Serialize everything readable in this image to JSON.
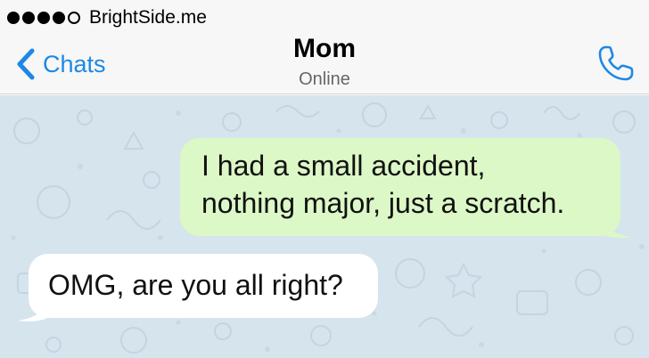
{
  "status_bar": {
    "carrier": "BrightSide.me",
    "signal_filled": 4,
    "signal_total": 5
  },
  "nav": {
    "back_label": "Chats",
    "back_icon": "chevron-left-icon",
    "call_icon": "phone-icon"
  },
  "contact": {
    "name": "Mom",
    "status": "Online"
  },
  "messages": [
    {
      "direction": "outgoing",
      "lines": [
        "I had a small accident,",
        "nothing major, just a scratch."
      ]
    },
    {
      "direction": "incoming",
      "lines": [
        "OMG, are you all right?"
      ]
    }
  ],
  "colors": {
    "accent": "#1e88e5",
    "outgoing_bubble": "#dcf8c6",
    "incoming_bubble": "#ffffff",
    "chat_background": "#d6e4ee"
  }
}
